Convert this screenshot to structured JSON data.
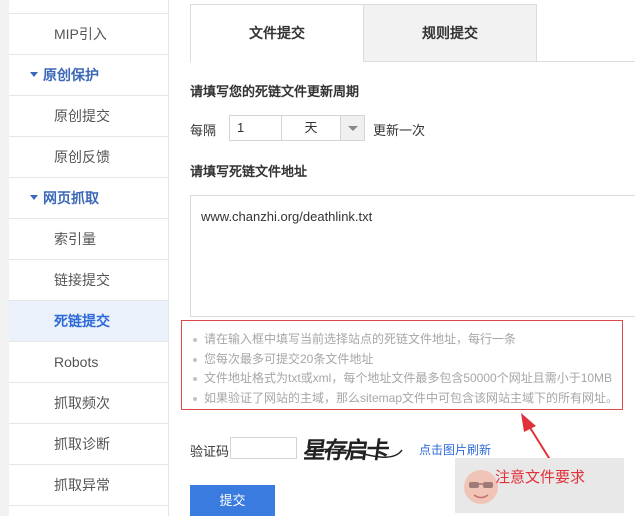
{
  "sidebar": {
    "items": [
      {
        "label": "MIP引入",
        "type": "item"
      },
      {
        "label": "原创保护",
        "type": "group"
      },
      {
        "label": "原创提交",
        "type": "item"
      },
      {
        "label": "原创反馈",
        "type": "item"
      },
      {
        "label": "网页抓取",
        "type": "group"
      },
      {
        "label": "索引量",
        "type": "item"
      },
      {
        "label": "链接提交",
        "type": "item"
      },
      {
        "label": "死链提交",
        "type": "item",
        "active": true
      },
      {
        "label": "Robots",
        "type": "item"
      },
      {
        "label": "抓取频次",
        "type": "item"
      },
      {
        "label": "抓取诊断",
        "type": "item"
      },
      {
        "label": "抓取异常",
        "type": "item"
      }
    ]
  },
  "tabs": [
    {
      "label": "文件提交",
      "active": true
    },
    {
      "label": "规则提交",
      "active": false
    }
  ],
  "form": {
    "period_heading": "请填写您的死链文件更新周期",
    "every_label": "每隔",
    "interval_value": "1",
    "unit_selected": "天",
    "update_suffix": "更新一次",
    "address_heading": "请填写死链文件地址",
    "address_value": "www.chanzhi.org/deathlink.txt",
    "notes": [
      "请在输入框中填写当前选择站点的死链文件地址，每行一条",
      "您每次最多可提交20条文件地址",
      "文件地址格式为txt或xml，每个地址文件最多包含50000个网址且需小于10MB",
      "如果验证了网站的主域，那么sitemap文件中可包含该网站主域下的所有网址。"
    ],
    "captcha_label": "验证码",
    "captcha_text": "星存启卡",
    "refresh_label": "点击图片刷新",
    "submit_label": "提交"
  },
  "annotation": {
    "text": "注意文件要求",
    "color": "#e0303a"
  },
  "colors": {
    "accent": "#3a7be0",
    "sidebar_group": "#3c68b8",
    "active_bg": "#eaf1fb",
    "note_border": "#d94a4a"
  }
}
